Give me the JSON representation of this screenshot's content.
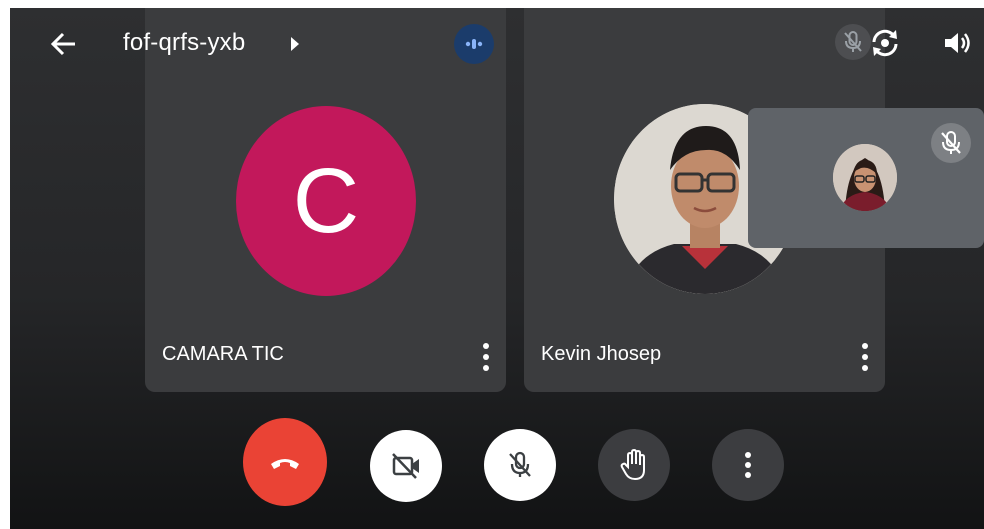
{
  "header": {
    "meeting_code": "fof-qrfs-yxb",
    "icons": [
      "arrow-back-icon",
      "chevron-right-icon",
      "speaking-indicator-icon",
      "mic-off-icon",
      "switch-camera-icon",
      "volume-icon"
    ]
  },
  "participants": [
    {
      "name": "CAMARA TIC",
      "avatar_letter": "C",
      "avatar_color": "#c2185b"
    },
    {
      "name": "Kevin Jhosep"
    }
  ],
  "self_view": {
    "muted": true
  },
  "controls": [
    "end-call",
    "camera-off",
    "mic-off",
    "raise-hand",
    "more-options"
  ],
  "colors": {
    "end_call": "#ea4335",
    "tile_bg": "#3b3c3e",
    "speaking_indicator": "#1b3c6b",
    "self_view_bg": "#5f6368"
  }
}
